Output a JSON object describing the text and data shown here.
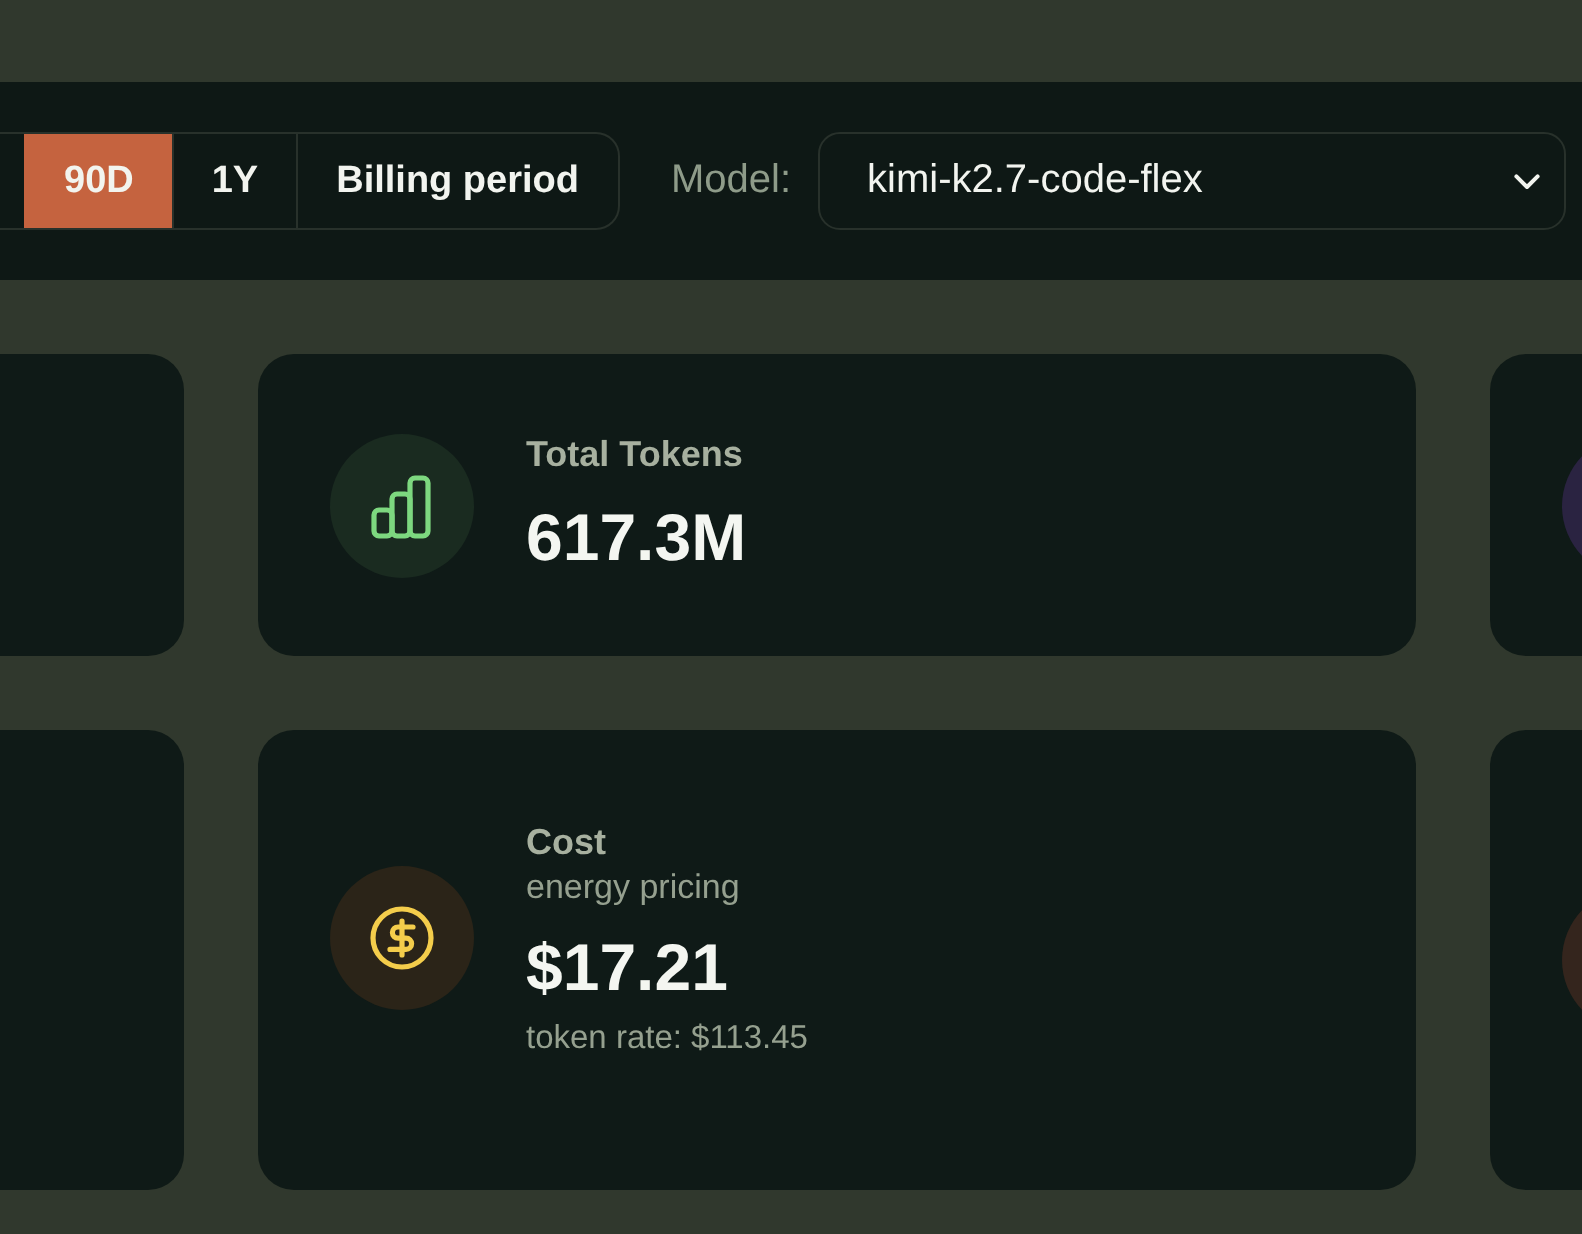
{
  "toolbar": {
    "periods": [
      {
        "label": "90D",
        "selected": true
      },
      {
        "label": "1Y",
        "selected": false
      },
      {
        "label": "Billing period",
        "selected": false
      }
    ],
    "model_label": "Model:",
    "model_select": {
      "value": "kimi-k2.7-code-flex"
    }
  },
  "card_rows": [
    {
      "cards": [
        {
          "kind": "clipped"
        },
        {
          "kind": "tokens",
          "label": "Total Tokens",
          "value": "617.3M",
          "color": "#7dd87f"
        },
        {
          "kind": "clipped",
          "color": "#2a2341"
        }
      ]
    },
    {
      "cards": [
        {
          "kind": "clipped"
        },
        {
          "kind": "cost",
          "label": "Cost",
          "subtitle": "energy pricing",
          "value": "$17.21",
          "note": "token rate: $113.45",
          "color": "#f4cd4b"
        },
        {
          "kind": "clipped",
          "color": "#34251d"
        }
      ]
    }
  ]
}
